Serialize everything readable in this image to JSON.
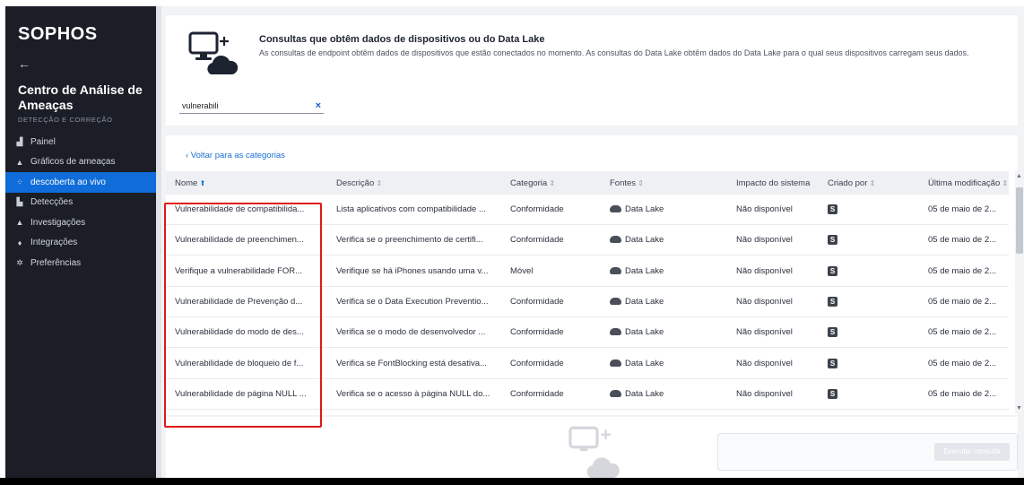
{
  "sidebar": {
    "logo": "SOPHOS",
    "back": "←",
    "title": "Centro de Análise de Ameaças",
    "subtitle": "DETECÇÃO E CORREÇÃO",
    "items": [
      {
        "label": "Painel",
        "icon": "bar-chart-icon",
        "glyph": "▟"
      },
      {
        "label": "Gráficos de ameaças",
        "icon": "threat-graph-icon",
        "glyph": "▲"
      },
      {
        "label": "descoberta ao vivo",
        "icon": "live-discover-icon",
        "glyph": "⁘",
        "active": true
      },
      {
        "label": "Detecções",
        "icon": "detections-icon",
        "glyph": "▙"
      },
      {
        "label": "Investigações",
        "icon": "investigations-icon",
        "glyph": "▲"
      },
      {
        "label": "Integrações",
        "icon": "integrations-icon",
        "glyph": "♦"
      },
      {
        "label": "Preferências",
        "icon": "gear-icon",
        "glyph": "✲"
      }
    ]
  },
  "header": {
    "title": "Consultas que obtêm dados de dispositivos ou do Data Lake",
    "description": "As consultas de endpoint obtêm dados de dispositivos que estão conectados no momento. As consultas do Data Lake obtêm dados do Data Lake para o qual seus dispositivos carregam seus dados."
  },
  "search": {
    "value": "vulnerabili",
    "clear": "×"
  },
  "back_link": "‹ Voltar para as categorias",
  "table": {
    "columns": [
      "Nome",
      "Descrição",
      "Categoria",
      "Fontes",
      "Impacto do sistema",
      "Criado por",
      "Última modificação"
    ],
    "rows": [
      {
        "name": "Vulnerabilidade de compatibilida...",
        "desc": "Lista aplicativos com compatibilidade ...",
        "cat": "Conformidade",
        "src": "Data Lake",
        "impact": "Não disponível",
        "by": "S",
        "mod": "05 de maio de 2..."
      },
      {
        "name": "Vulnerabilidade de preenchimen...",
        "desc": "Verifica se o preenchimento de certifi...",
        "cat": "Conformidade",
        "src": "Data Lake",
        "impact": "Não disponível",
        "by": "S",
        "mod": "05 de maio de 2..."
      },
      {
        "name": "Verifique a vulnerabilidade FOR...",
        "desc": "Verifique se há iPhones usando uma v...",
        "cat": "Móvel",
        "src": "Data Lake",
        "impact": "Não disponível",
        "by": "S",
        "mod": "05 de maio de 2..."
      },
      {
        "name": "Vulnerabilidade de Prevenção d...",
        "desc": "Verifica se o Data Execution Preventio...",
        "cat": "Conformidade",
        "src": "Data Lake",
        "impact": "Não disponível",
        "by": "S",
        "mod": "05 de maio de 2..."
      },
      {
        "name": "Vulnerabilidade do modo de des...",
        "desc": "Verifica se o modo de desenvolvedor ...",
        "cat": "Conformidade",
        "src": "Data Lake",
        "impact": "Não disponível",
        "by": "S",
        "mod": "05 de maio de 2..."
      },
      {
        "name": "Vulnerabilidade de bloqueio de f...",
        "desc": "Verifica se FontBlocking está desativa...",
        "cat": "Conformidade",
        "src": "Data Lake",
        "impact": "Não disponível",
        "by": "S",
        "mod": "05 de maio de 2..."
      },
      {
        "name": "Vulnerabilidade de página NULL ...",
        "desc": "Verifica se o acesso à página NULL do...",
        "cat": "Conformidade",
        "src": "Data Lake",
        "impact": "Não disponível",
        "by": "S",
        "mod": "05 de maio de 2..."
      }
    ]
  },
  "run_button": "Executar consulta",
  "colors": {
    "accent": "#0f6cd9",
    "sidebar_bg": "#1b1e26",
    "highlight": "#e01818"
  }
}
